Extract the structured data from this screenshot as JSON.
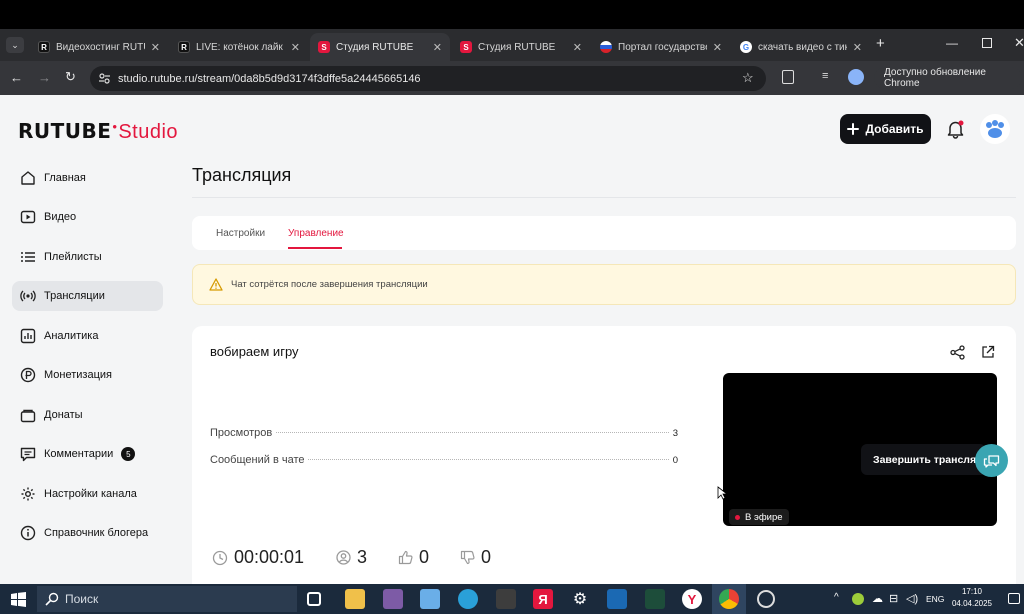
{
  "browser": {
    "tabs": [
      {
        "title": "Видеохостинг RUTUBE",
        "favicon": "rutube-logo-icon"
      },
      {
        "title": "LIVE: котёнок лайк с",
        "favicon": "rutube-logo-icon"
      },
      {
        "title": "Студия RUTUBE",
        "favicon": "rutube-studio-icon",
        "active": true
      },
      {
        "title": "Студия RUTUBE",
        "favicon": "rutube-studio-icon"
      },
      {
        "title": "Портал государствен",
        "favicon": "russia-flag-icon"
      },
      {
        "title": "скачать видео с тик",
        "favicon": "google-icon"
      }
    ],
    "url": "studio.rutube.ru/stream/0da8b5d9d3174f3dffe5a24445665146",
    "update_label": "Доступно обновление Chrome"
  },
  "header": {
    "logo_main": "RUTUBE",
    "logo_sub": "Studio",
    "add_label": "Добавить"
  },
  "sidebar": {
    "items": [
      {
        "label": "Главная",
        "icon": "home-icon"
      },
      {
        "label": "Видео",
        "icon": "video-icon"
      },
      {
        "label": "Плейлисты",
        "icon": "playlist-icon"
      },
      {
        "label": "Трансляции",
        "icon": "broadcast-icon",
        "active": true
      },
      {
        "label": "Аналитика",
        "icon": "analytics-icon"
      },
      {
        "label": "Монетизация",
        "icon": "monetization-icon"
      },
      {
        "label": "Донаты",
        "icon": "donate-icon"
      },
      {
        "label": "Комментарии",
        "icon": "comments-icon",
        "badge": "5"
      },
      {
        "label": "Настройки канала",
        "icon": "gear-icon"
      },
      {
        "label": "Справочник блогера",
        "icon": "info-icon"
      }
    ]
  },
  "main": {
    "title": "Трансляция",
    "tabs": [
      "Настройки",
      "Управление"
    ],
    "active_tab": "Управление",
    "warning": "Чат сотрётся после завершения трансляции",
    "stream": {
      "name": "вобираем игру",
      "stats": [
        {
          "label": "Просмотров",
          "value": "3"
        },
        {
          "label": "Сообщений в чате",
          "value": "0"
        }
      ],
      "live_label": "В эфире",
      "duration": "00:00:01",
      "viewers": "3",
      "likes": "0",
      "dislikes": "0",
      "end_label": "Завершить трансляцию"
    }
  },
  "taskbar": {
    "search_placeholder": "Поиск",
    "lang": "ENG",
    "time": "17:10",
    "date": "04.04.2025"
  },
  "colors": {
    "accent": "#e3173e",
    "warning_bg": "#fff8e0",
    "teal": "#3aa5b2"
  }
}
